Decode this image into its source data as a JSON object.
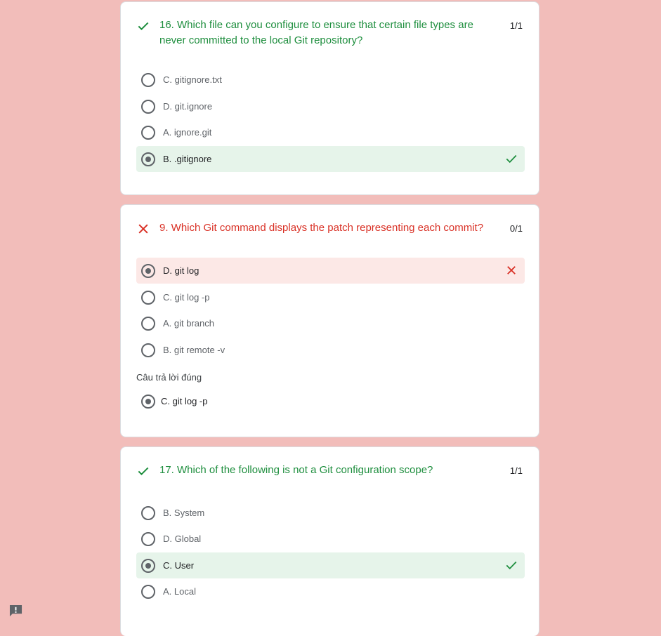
{
  "colors": {
    "correct": "#1e8e3e",
    "wrong": "#d93025",
    "background": "#f2bdba"
  },
  "questions": [
    {
      "title": "16. Which file can you configure to ensure that certain file types are never committed to the local Git repository?",
      "score": "1/1",
      "status": "correct",
      "options": [
        {
          "label": "C. gitignore.txt",
          "selected": false
        },
        {
          "label": "D. git.ignore",
          "selected": false
        },
        {
          "label": "A. ignore.git",
          "selected": false
        },
        {
          "label": "B. .gitignore",
          "selected": true,
          "result": "correct"
        }
      ]
    },
    {
      "title": "9. Which Git command displays the patch representing each commit?",
      "score": "0/1",
      "status": "wrong",
      "options": [
        {
          "label": "D. git log",
          "selected": true,
          "result": "wrong"
        },
        {
          "label": "C. git log -p",
          "selected": false
        },
        {
          "label": "A. git branch",
          "selected": false
        },
        {
          "label": "B. git remote -v",
          "selected": false
        }
      ],
      "correct_answer_heading": "Câu trả lời đúng",
      "correct_answer": "C. git log -p"
    },
    {
      "title": "17. Which of the following is not a Git configuration scope?",
      "score": "1/1",
      "status": "correct",
      "options": [
        {
          "label": "B. System",
          "selected": false
        },
        {
          "label": "D. Global",
          "selected": false
        },
        {
          "label": "C. User",
          "selected": true,
          "result": "correct"
        },
        {
          "label": "A. Local",
          "selected": false
        }
      ]
    }
  ],
  "icons": {
    "check": "check-icon",
    "cross": "close-icon",
    "feedback": "report-icon"
  }
}
